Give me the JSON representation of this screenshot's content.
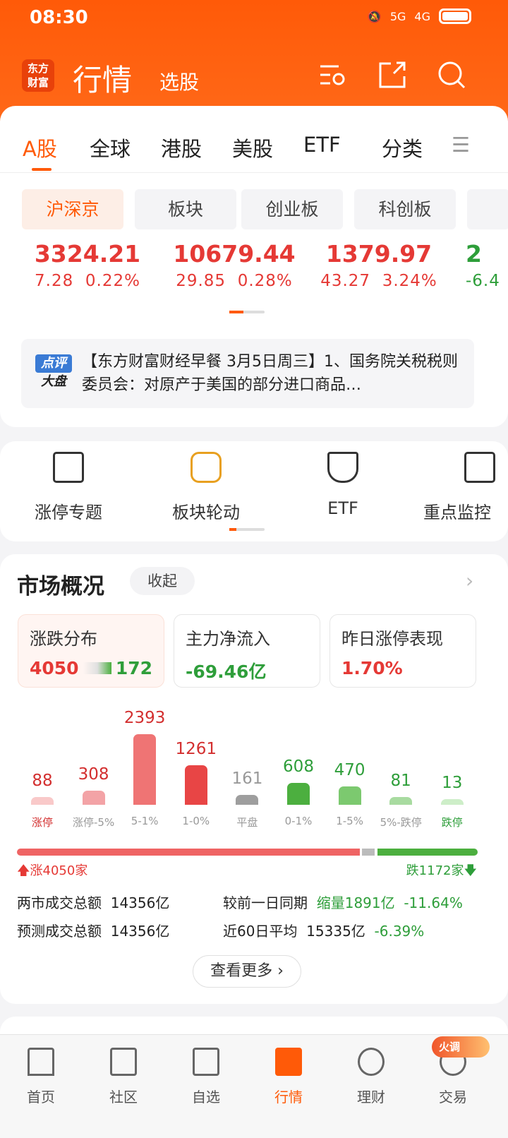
{
  "status": {
    "time": "08:30",
    "net1": "5G",
    "net2": "4G"
  },
  "header": {
    "logo": "东方财富",
    "title": "行情",
    "subtitle": "选股"
  },
  "tabs": [
    {
      "label": "A股",
      "active": true
    },
    {
      "label": "全球"
    },
    {
      "label": "港股"
    },
    {
      "label": "美股"
    },
    {
      "label": "ETF"
    },
    {
      "label": "分类"
    }
  ],
  "subtabs": [
    {
      "label": "沪深京",
      "active": true
    },
    {
      "label": "板块"
    },
    {
      "label": "创业板"
    },
    {
      "label": "科创板"
    }
  ],
  "indices": [
    {
      "value": "3324.21",
      "change": "7.28",
      "pct": "0.22%"
    },
    {
      "value": "10679.44",
      "change": "29.85",
      "pct": "0.28%"
    },
    {
      "value": "1379.97",
      "change": "43.27",
      "pct": "3.24%"
    },
    {
      "value": "2",
      "change": "-6.4"
    }
  ],
  "news": {
    "badge_top": "点评",
    "badge_bottom": "大盘",
    "text": "【东方财富财经早餐 3月5日周三】1、国务院关税税则委员会：对原产于美国的部分进口商品…"
  },
  "tools": [
    {
      "label": "涨停专题",
      "icon": "limit-up-icon"
    },
    {
      "label": "板块轮动",
      "icon": "rotation-icon"
    },
    {
      "label": "ETF",
      "icon": "etf-icon"
    },
    {
      "label": "重点监控",
      "icon": "monitor-icon"
    }
  ],
  "market": {
    "title": "市场概况",
    "collapse": "收起",
    "cards": [
      {
        "label": "涨跌分布",
        "up": "4050",
        "down": "172"
      },
      {
        "label": "主力净流入",
        "value": "-69.46亿"
      },
      {
        "label": "昨日涨停表现",
        "value": "1.70%"
      }
    ],
    "up_total": "涨4050家",
    "down_total": "跌1172家",
    "stats": [
      {
        "label": "两市成交总额",
        "value": "14356亿",
        "label2": "较前一日同期",
        "value2": "缩量1891亿",
        "pct2": "-11.64%"
      },
      {
        "label": "预测成交总额",
        "value": "14356亿",
        "label2": "近60日平均",
        "value2": "15335亿",
        "pct2": "-6.39%"
      }
    ],
    "more": "查看更多"
  },
  "chart_data": {
    "type": "bar",
    "categories": [
      "涨停",
      "涨停-5%",
      "5-1%",
      "1-0%",
      "平盘",
      "0-1%",
      "1-5%",
      "5%-跌停",
      "跌停"
    ],
    "values": [
      88,
      308,
      2393,
      1261,
      161,
      608,
      470,
      81,
      13
    ],
    "colors": [
      "#f9c9c9",
      "#f3a3a6",
      "#ef7474",
      "#e84545",
      "#9e9e9e",
      "#4caf3f",
      "#7cc96f",
      "#a8dba0",
      "#cdeec8"
    ]
  },
  "nav": [
    {
      "label": "首页"
    },
    {
      "label": "社区"
    },
    {
      "label": "自选"
    },
    {
      "label": "行情",
      "active": true
    },
    {
      "label": "理财"
    },
    {
      "label": "交易",
      "badge": "火调"
    }
  ],
  "colors": {
    "accent": "#ff5a08",
    "up": "#e53935",
    "down": "#2e9e3a"
  }
}
